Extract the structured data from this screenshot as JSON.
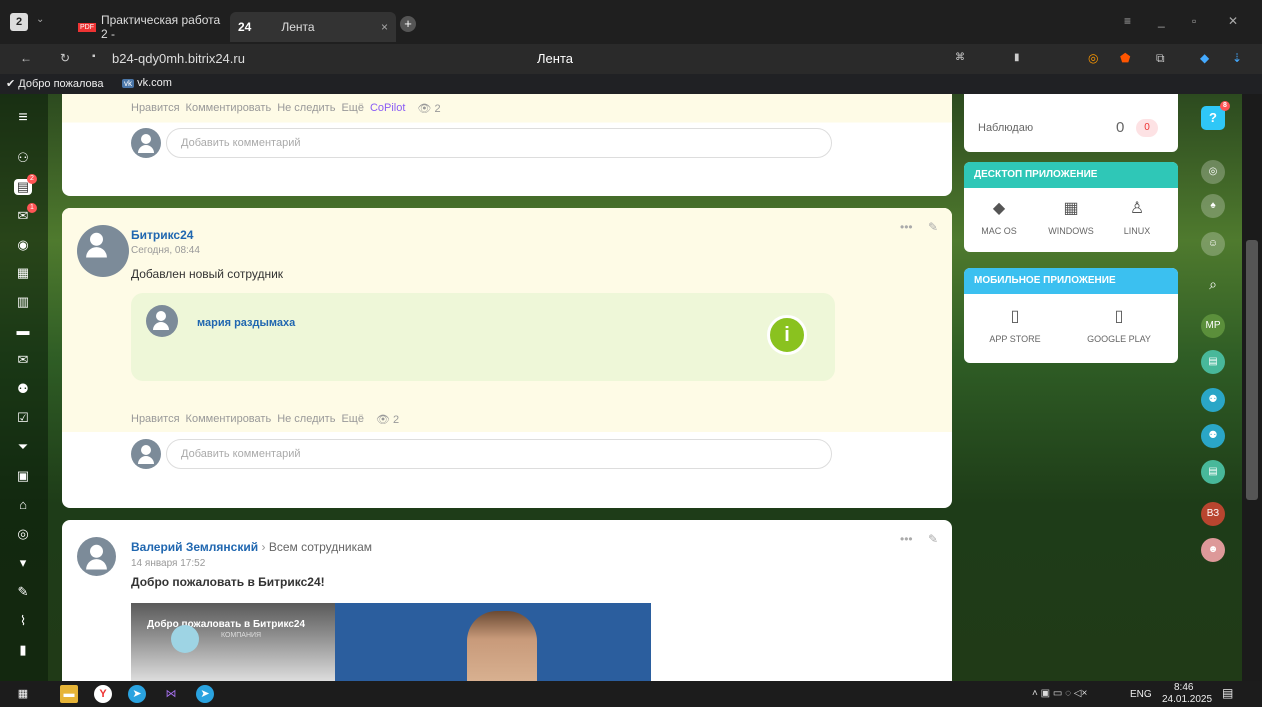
{
  "browser": {
    "tab_count": "2",
    "tabs": [
      {
        "label": "Практическая работа 2 -"
      },
      {
        "label": "Лента",
        "badge": "24"
      }
    ],
    "address": "b24-qdy0mh.bitrix24.ru",
    "page_title": "Лента",
    "bookmarks": [
      "Добро пожалова",
      "vk.com"
    ]
  },
  "left_nav": {
    "badges": [
      "2",
      "1"
    ]
  },
  "posts": [
    {
      "actions": [
        "Нравится",
        "Комментировать",
        "Не следить",
        "Ещё",
        "CoPilot"
      ],
      "views": "2",
      "comment_placeholder": "Добавить комментарий"
    },
    {
      "author": "Битрикс24",
      "date": "Сегодня, 08:44",
      "text": "Добавлен новый сотрудник",
      "employee": "мария раздымаха",
      "actions": [
        "Нравится",
        "Комментировать",
        "Не следить",
        "Ещё"
      ],
      "views": "2",
      "comment_placeholder": "Добавить комментарий"
    },
    {
      "author": "Валерий Землянский",
      "recipient": "Всем сотрудникам",
      "date": "14 января 17:52",
      "text": "Добро пожаловать в Битрикс24!",
      "video_title": "Добро пожаловать в Битрикс24",
      "video_sub": "компания"
    }
  ],
  "widgets": {
    "watching": {
      "label": "Наблюдаю",
      "count": "0",
      "badge": "0"
    },
    "desktop": {
      "title": "ДЕСКТОП ПРИЛОЖЕНИЕ",
      "items": [
        "MAC OS",
        "WINDOWS",
        "LINUX"
      ],
      "color": "#2fc7b7"
    },
    "mobile": {
      "title": "МОБИЛЬНОЕ ПРИЛОЖЕНИЕ",
      "items": [
        "APP STORE",
        "GOOGLE PLAY"
      ],
      "color": "#3bc0f0"
    }
  },
  "right_bar": {
    "help_badge": "8",
    "mp": "МР",
    "b3": "ВЗ"
  },
  "taskbar": {
    "lang": "ENG",
    "time": "8:46",
    "date": "24.01.2025"
  }
}
